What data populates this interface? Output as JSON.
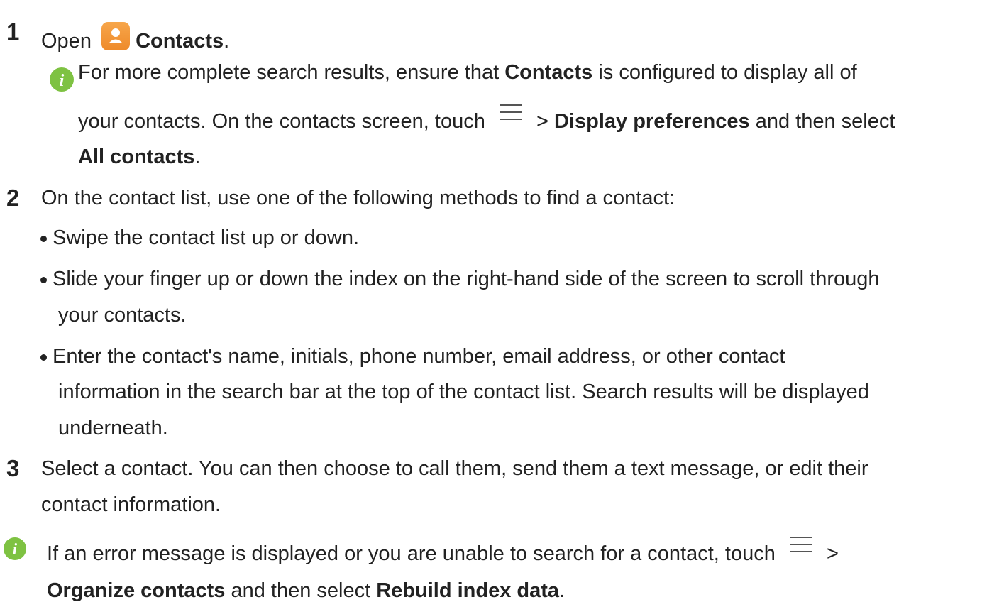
{
  "steps": [
    {
      "number": "1",
      "open_label": "Open",
      "app_name": "Contacts",
      "end": ".",
      "note": {
        "icon": "info-icon",
        "part1": "For more complete search results, ensure that",
        "bold1": "Contacts",
        "part2": "is configured to display all of",
        "part3": "your contacts. On the contacts screen, touch",
        "menu_icon": "menu-icon",
        "arrow": ">",
        "bold2": "Display preferences",
        "part4": "and then select",
        "bold3": "All contacts",
        "end": "."
      }
    },
    {
      "number": "2",
      "text": "On the contact list, use one of the following methods to find a contact:",
      "bullets": [
        [
          "Swipe the contact list up or down."
        ],
        [
          "Slide your finger up or down the index on the right-hand side of the screen to scroll through",
          "your contacts."
        ],
        [
          "Enter the contact's name, initials, phone number, email address, or other contact",
          "information in the search bar at the top of the contact list. Search results will be displayed",
          "underneath."
        ]
      ]
    },
    {
      "number": "3",
      "lines": [
        "Select a contact. You can then choose to call them, send them a text message, or edit their",
        "contact information."
      ]
    }
  ],
  "bottom_note": {
    "icon": "info-icon",
    "part1": "If an error message is displayed or you are unable to search for a contact, touch",
    "menu_icon": "menu-icon",
    "arrow": ">",
    "bold1": "Organize contacts",
    "part2": "and then select",
    "bold2": "Rebuild index data",
    "end": "."
  },
  "colors": {
    "info_icon": "#7ec242",
    "contacts_icon": "#f29434",
    "text": "#222222"
  }
}
